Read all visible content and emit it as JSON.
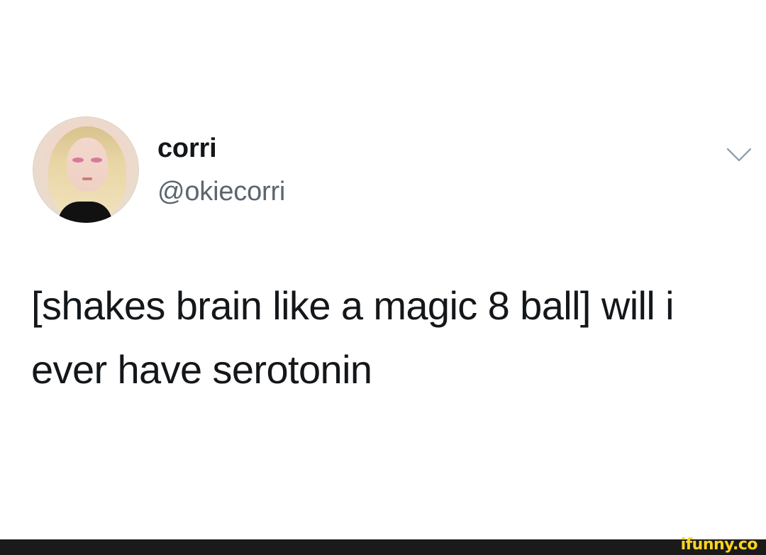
{
  "tweet": {
    "author": {
      "display_name": "corri",
      "handle": "@okiecorri",
      "avatar_icon": "profile-avatar"
    },
    "text": "[shakes brain like a magic 8 ball] will i ever have serotonin",
    "menu_icon": "chevron-down-icon"
  },
  "footer": {
    "watermark": "ifunny.co",
    "colors": {
      "background": "#1a1a1a",
      "watermark": "#ffd51e"
    }
  }
}
